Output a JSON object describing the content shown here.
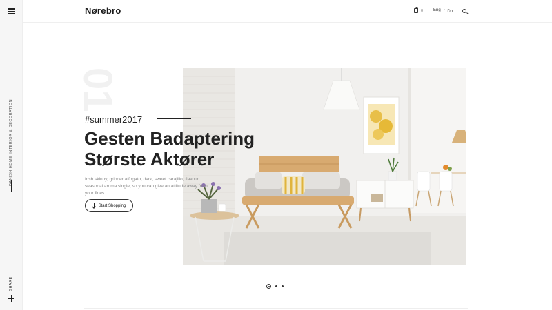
{
  "brand": {
    "logo": "Nørebro"
  },
  "rail": {
    "vertical_text": "Danish Home Interior & Decoration",
    "share_label": "Share"
  },
  "header": {
    "cart_count": "0",
    "lang_active": "Eng",
    "lang_separator": "/",
    "lang_other": "Dn"
  },
  "hero": {
    "slide_number": "01",
    "hashtag": "#summer2017",
    "headline_line1": "Gesten Badaptering",
    "headline_line2": "Største Aktører",
    "description": "Irish skinny, grinder affogato, dark, sweet carajillo, flavour seasonal aroma single, so you can give an attitude away from your fines.",
    "cta_label": "Start Shopping"
  },
  "slider": {
    "active_index": 1,
    "total": 3
  },
  "icons": [
    "hamburger-icon",
    "plus-icon",
    "bag-icon",
    "search-icon",
    "arrow-down-icon"
  ],
  "colors": {
    "text": "#222222",
    "rail_bg": "#f6f6f6",
    "mustard": "#e2b437",
    "wood": "#d5a66b"
  }
}
